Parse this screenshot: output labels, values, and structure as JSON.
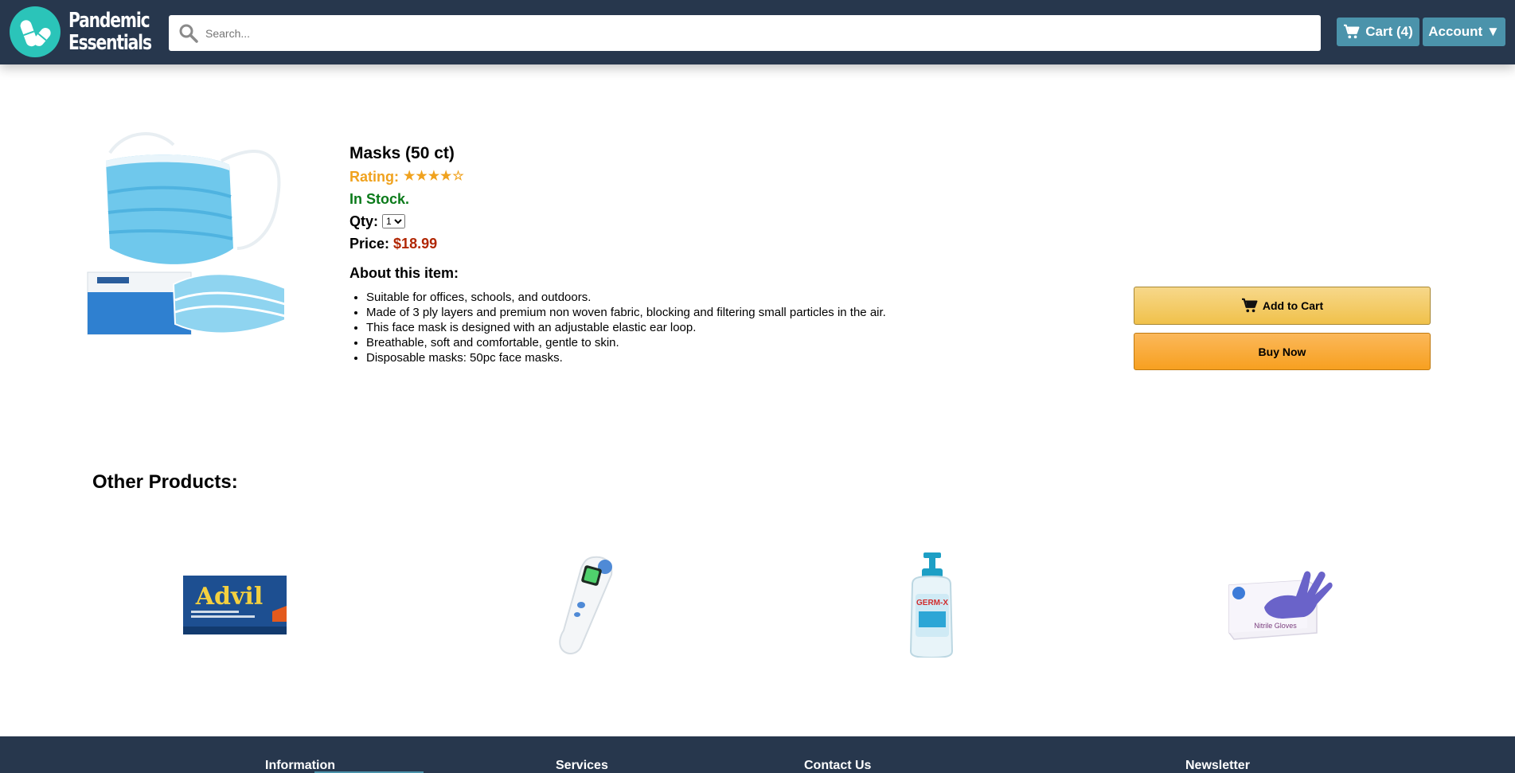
{
  "header": {
    "logo_line1": "Pandemic",
    "logo_line2": "Essentials",
    "search_placeholder": "Search...",
    "cart_label": "Cart (4)",
    "account_label": "Account ▼"
  },
  "product": {
    "image_icon": "face-mask-box-image",
    "title": "Masks (50 ct)",
    "rating_label": "Rating:",
    "rating_value": 4,
    "rating_max": 5,
    "rating_stars": "★★★★☆",
    "stock": "In Stock.",
    "qty_label": "Qty:",
    "qty_value": "1",
    "price_label": "Price:",
    "price_value": "$18.99",
    "about_heading": "About this item:",
    "bullets": [
      "Suitable for offices, schools, and outdoors.",
      "Made of 3 ply layers and premium non woven fabric, blocking and filtering small particles in the air.",
      "This face mask is designed with an adjustable elastic ear loop.",
      "Breathable, soft and comfortable, gentle to skin.",
      "Disposable masks: 50pc face masks."
    ]
  },
  "actions": {
    "add_to_cart": "Add to Cart",
    "buy_now": "Buy Now"
  },
  "other_products": {
    "heading": "Other Products:",
    "items": [
      {
        "icon": "advil-box-image",
        "brand": "Advil"
      },
      {
        "icon": "thermometer-image"
      },
      {
        "icon": "hand-sanitizer-image",
        "brand": "GERM-X"
      },
      {
        "icon": "nitrile-gloves-image",
        "label": "Nitrile Gloves"
      }
    ]
  },
  "footer": {
    "columns": [
      "Information",
      "Services",
      "Contact Us",
      "Newsletter"
    ]
  },
  "colors": {
    "header_bg": "#27374d",
    "header_button": "#4b93ab",
    "logo": "#2bc4b9",
    "rating": "#f0a21e",
    "in_stock": "#0b7a1a",
    "price": "#b12704",
    "add_to_cart": "#f0c14b",
    "buy_now": "#f7a020"
  }
}
